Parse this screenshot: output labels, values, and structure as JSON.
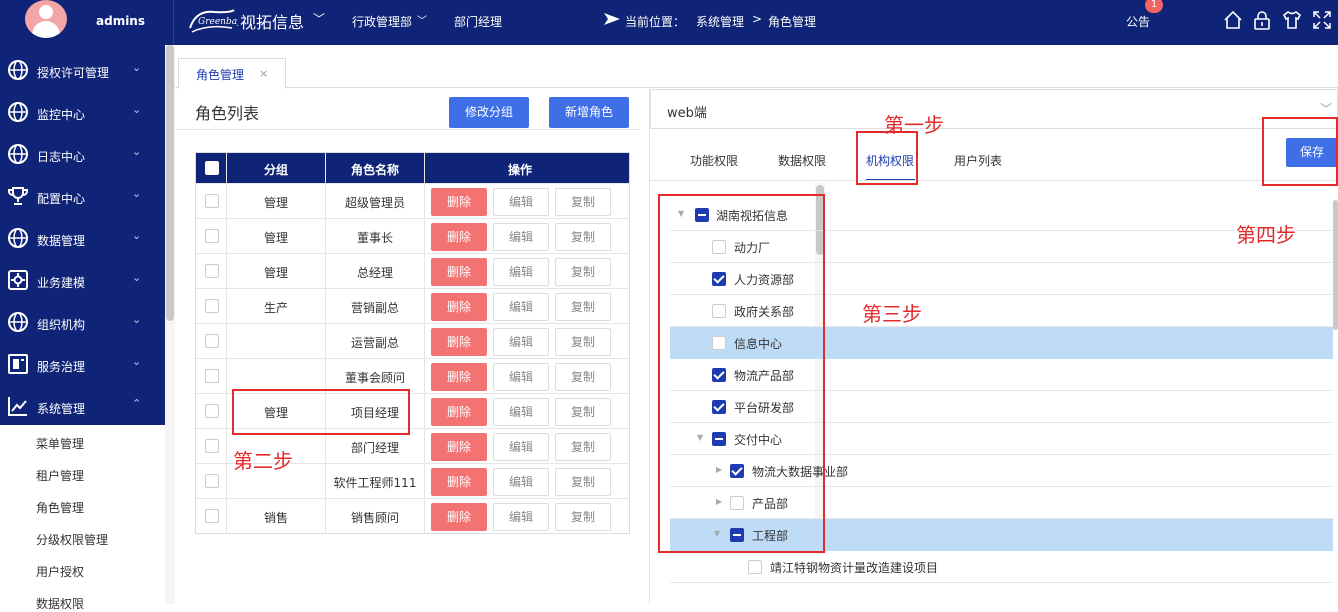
{
  "topbar": {
    "user_name": "admins",
    "brand": "视拓信息",
    "department": "行政管理部",
    "role": "部门经理",
    "location_label": "当前位置：",
    "breadcrumb": [
      "系统管理",
      "角色管理"
    ],
    "breadcrumb_sep": ">",
    "notice_label": "公告",
    "notice_count": "1",
    "icons": [
      "home-icon",
      "lock-icon",
      "shirt-icon",
      "fullscreen-icon"
    ]
  },
  "sidebar": {
    "items": [
      {
        "label": "授权许可管理",
        "icon": "globe-icon",
        "chev": "⌄"
      },
      {
        "label": "监控中心",
        "icon": "globe-icon",
        "chev": "⌄"
      },
      {
        "label": "日志中心",
        "icon": "globe-icon",
        "chev": "⌄"
      },
      {
        "label": "配置中心",
        "icon": "trophy-icon",
        "chev": "⌄"
      },
      {
        "label": "数据管理",
        "icon": "globe-icon",
        "chev": "⌄"
      },
      {
        "label": "业务建模",
        "icon": "gear-box-icon",
        "chev": "⌄"
      },
      {
        "label": "组织机构",
        "icon": "globe-icon",
        "chev": "⌄"
      },
      {
        "label": "服务治理",
        "icon": "document-icon",
        "chev": "⌄"
      },
      {
        "label": "系统管理",
        "icon": "chart-line-icon",
        "chev": "⌃"
      }
    ],
    "sub_items": [
      "菜单管理",
      "租户管理",
      "角色管理",
      "分级权限管理",
      "用户授权",
      "数据权限"
    ]
  },
  "tabs": [
    {
      "label": "角色管理",
      "close": "×"
    }
  ],
  "role_list": {
    "title": "角色列表",
    "edit_group_button": "修改分组",
    "add_role_button": "新增角色",
    "columns": [
      "分组",
      "角色名称",
      "操作"
    ],
    "row_actions": {
      "delete": "删除",
      "edit": "编辑",
      "copy": "复制"
    },
    "rows": [
      {
        "group": "管理",
        "name": "超级管理员"
      },
      {
        "group": "管理",
        "name": "董事长"
      },
      {
        "group": "管理",
        "name": "总经理"
      },
      {
        "group": "生产",
        "name": "营销副总"
      },
      {
        "group": "",
        "name": "运营副总"
      },
      {
        "group": "",
        "name": "董事会顾问"
      },
      {
        "group": "管理",
        "name": "项目经理"
      },
      {
        "group": "",
        "name": "部门经理"
      },
      {
        "group": "",
        "name": "软件工程师111"
      },
      {
        "group": "销售",
        "name": "销售顾问"
      }
    ]
  },
  "permissions": {
    "client_select": "web端",
    "tabs": [
      "功能权限",
      "数据权限",
      "机构权限",
      "用户列表"
    ],
    "active_tab": "机构权限",
    "save_button": "保存",
    "tree": [
      {
        "label": "湖南视拓信息",
        "state": "half",
        "expanded": true,
        "level": 0
      },
      {
        "label": "动力厂",
        "state": "off",
        "level": 1
      },
      {
        "label": "人力资源部",
        "state": "on",
        "level": 1
      },
      {
        "label": "政府关系部",
        "state": "off",
        "level": 1
      },
      {
        "label": "信息中心",
        "state": "off",
        "level": 1,
        "highlight": true
      },
      {
        "label": "物流产品部",
        "state": "on",
        "level": 1
      },
      {
        "label": "平台研发部",
        "state": "on",
        "level": 1
      },
      {
        "label": "交付中心",
        "state": "half",
        "expanded": true,
        "level": 1
      },
      {
        "label": "物流大数据事业部",
        "state": "on",
        "collapsed": true,
        "level": 2
      },
      {
        "label": "产品部",
        "state": "off",
        "collapsed": true,
        "level": 2
      },
      {
        "label": "工程部",
        "state": "half",
        "expanded": true,
        "level": 2,
        "highlight": true
      },
      {
        "label": "靖江特钢物资计量改造建设项目",
        "state": "off",
        "level": 3
      }
    ]
  },
  "annotations": {
    "step1": "第一步",
    "step2": "第二步",
    "step3": "第三步",
    "step4": "第四步",
    "color": "#e32b2b"
  },
  "colors": {
    "nav_bg": "#0f2477",
    "accent": "#3e6fe6",
    "danger": "#f37272",
    "highlight": "#bfdcf7"
  }
}
